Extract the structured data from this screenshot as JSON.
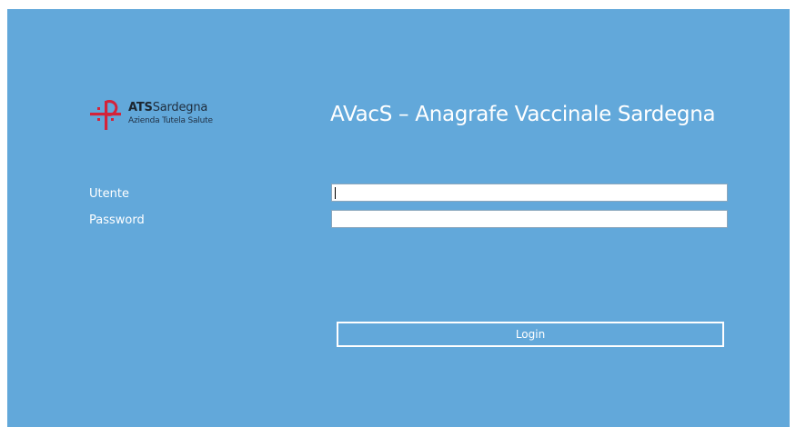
{
  "logo": {
    "brand_bold": "ATS",
    "brand_rest": "Sardegna",
    "tagline": "Azienda Tutela Salute",
    "icon": "ats-cross-icon",
    "brand_color": "#d4233a"
  },
  "header": {
    "title": "AVacS – Anagrafe Vaccinale Sardegna"
  },
  "form": {
    "username_label": "Utente",
    "username_value": "",
    "password_label": "Password",
    "password_value": "",
    "login_label": "Login"
  },
  "colors": {
    "panel_background": "#62a8da",
    "text": "#ffffff"
  }
}
